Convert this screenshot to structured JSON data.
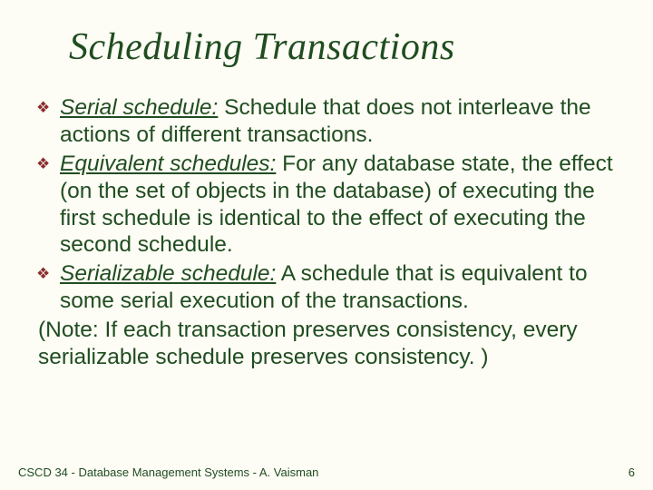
{
  "title": "Scheduling Transactions",
  "bullets": [
    {
      "term": "Serial schedule:",
      "text": " Schedule that does not interleave the actions of different transactions."
    },
    {
      "term": "Equivalent schedules:",
      "text": "  For any database state, the effect (on the set of objects in the database) of executing the first schedule is identical to the effect of executing the second schedule."
    },
    {
      "term": "Serializable schedule:",
      "text": "  A schedule that is equivalent to some serial execution of the transactions."
    }
  ],
  "note": "(Note: If each transaction preserves consistency, every serializable schedule preserves consistency. )",
  "footer": {
    "left": "CSCD 34 - Database Management Systems - A. Vaisman",
    "right": "6"
  }
}
